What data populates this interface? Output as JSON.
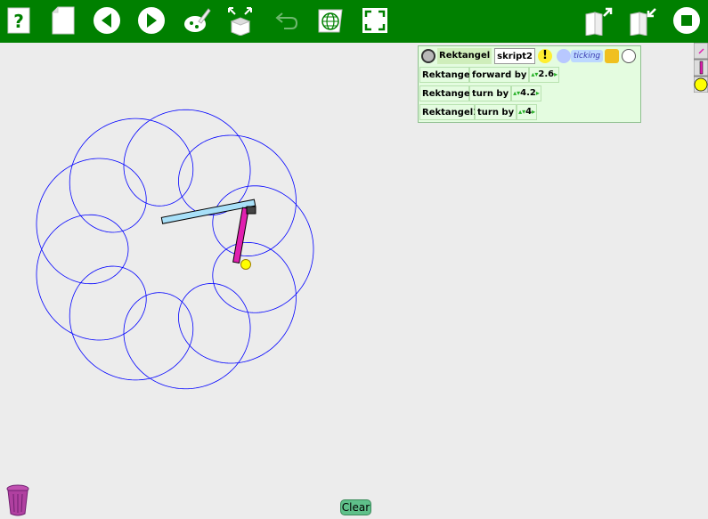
{
  "toolbar": {
    "buttons": [
      "help-icon",
      "new-page-icon",
      "previous-page-icon",
      "next-page-icon",
      "paint-icon",
      "supplies-icon",
      "undo-icon",
      "language-icon",
      "full-screen-icon",
      "load-project-icon",
      "save-project-icon",
      "stop-icon"
    ]
  },
  "script": {
    "header_object": "Rektangel",
    "header_script": "skript2",
    "header_status": "ticking",
    "rows": [
      {
        "object": "Rektangel",
        "command": "forward by",
        "value": "2.6"
      },
      {
        "object": "Rektangel",
        "command": "turn by",
        "value": "4.2"
      },
      {
        "object": "Rektangel1",
        "command": "turn by",
        "value": "4"
      }
    ]
  },
  "bottom": {
    "clear_label": "Clear"
  },
  "colors": {
    "toolbar": "#008000",
    "pen": "#0000ff",
    "long_arm": "#a8e0f8",
    "short_arm": "#e020b0",
    "pen_tip": "#ffff00",
    "script_bg": "#e4fce0"
  }
}
